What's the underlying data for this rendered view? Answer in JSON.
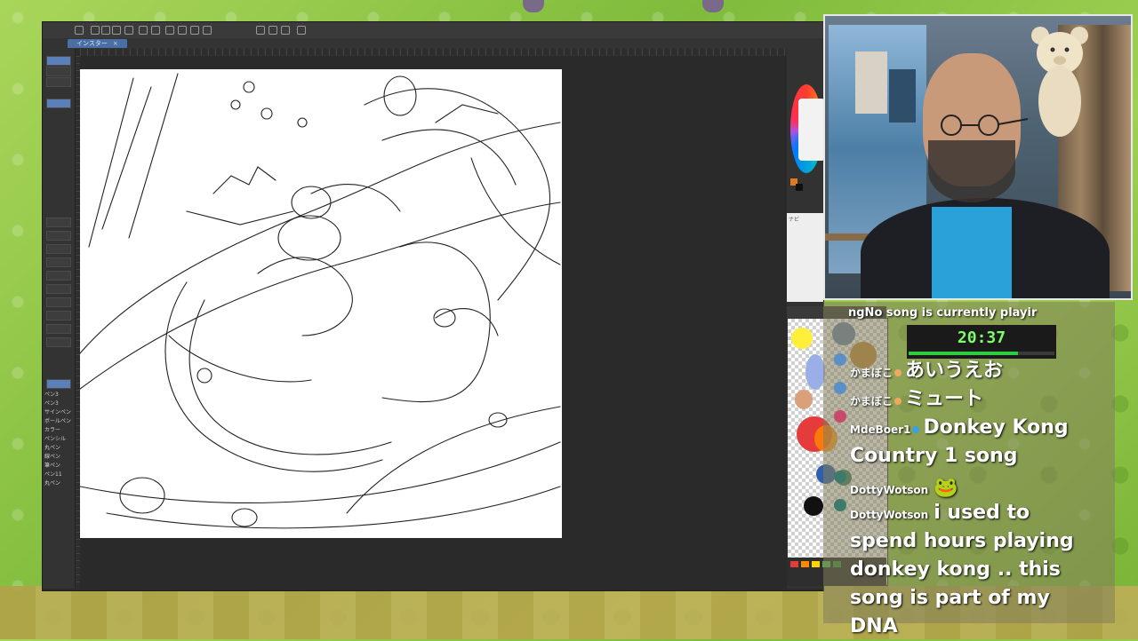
{
  "app": {
    "doc_tab_label": "インスター",
    "doc_tab_close": "×",
    "tools": [
      {
        "label": "ペン3"
      },
      {
        "label": "ペン3"
      },
      {
        "label": "サインペン"
      },
      {
        "label": "ボールペン"
      },
      {
        "label": "カラー"
      },
      {
        "label": "ペンシル"
      },
      {
        "label": "丸ペン"
      },
      {
        "label": "線ペン"
      },
      {
        "label": "筆ペン"
      },
      {
        "label": "ペン11"
      },
      {
        "label": "丸ペン"
      }
    ],
    "navigator_label": "ナビ",
    "colors": {
      "main": "#e07a1f",
      "sub": "#111111"
    },
    "palette_colors": [
      "#ffef3a",
      "#6ea0d8",
      "#8a9bb4",
      "#c48a3c",
      "#ff8a00",
      "#e63b3b",
      "#f06c9b",
      "#2f5fa8",
      "#111111",
      "#e63b3b",
      "#ff8a00",
      "#ffd400",
      "#4cb050",
      "#2f8f3b"
    ]
  },
  "stream": {
    "song_ticker": "ngNo song is currently playir",
    "timer": "20:37",
    "timer_progress": 0.75
  },
  "chat": [
    {
      "user": "かまぼこ",
      "text": "あいうえお"
    },
    {
      "user": "かまぼこ",
      "text": "ミュート"
    },
    {
      "user": "MdeBoer1",
      "text": "Donkey Kong Country 1 song"
    },
    {
      "user": "DottyWotson",
      "text": "🐸"
    },
    {
      "user": "DottyWotson",
      "text": "i used to spend hours playing donkey kong .. this song is part of my DNA"
    }
  ]
}
